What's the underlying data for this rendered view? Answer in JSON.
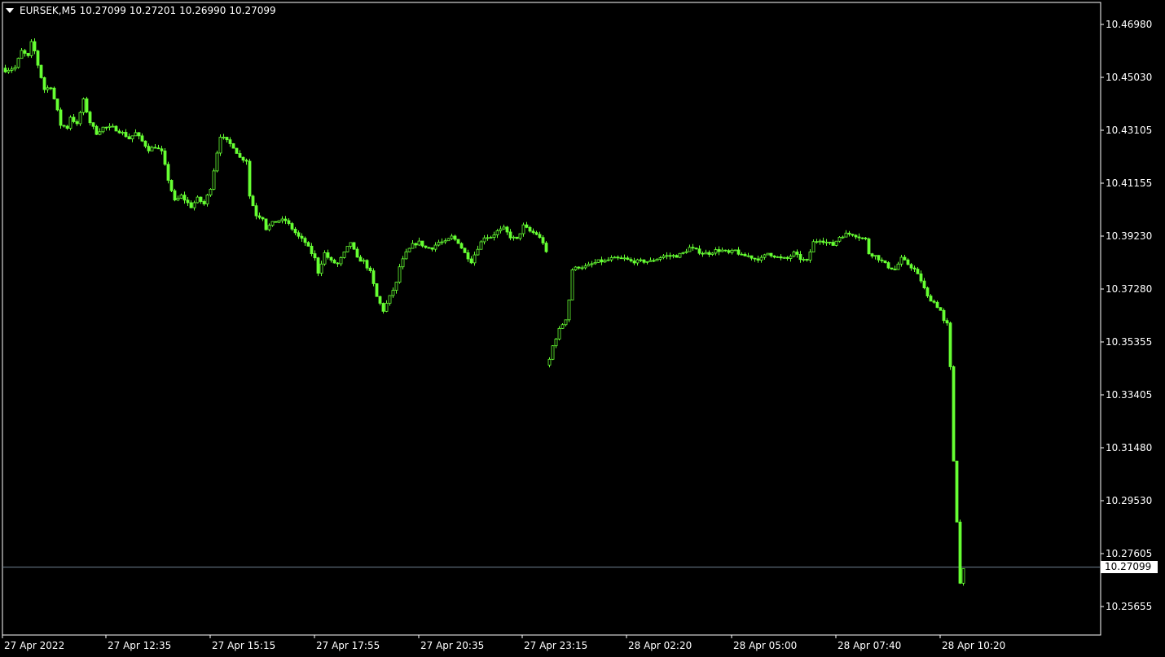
{
  "header": {
    "symbol": "EURSEK,M5",
    "open": "10.27099",
    "high": "10.27201",
    "low": "10.26990",
    "close": "10.27099"
  },
  "colors": {
    "background": "#000000",
    "candle": "#66ff33",
    "frame": "#ffffff",
    "grid_line": "#708090",
    "label_bg": "#ffffff",
    "label_text": "#000000"
  },
  "chart_data": {
    "type": "candlestick",
    "timeframe": "M5",
    "ylim": [
      10.252,
      10.477
    ],
    "y_ticks": [
      "10.46980",
      "10.45030",
      "10.43105",
      "10.41155",
      "10.39230",
      "10.37280",
      "10.35355",
      "10.33405",
      "10.31480",
      "10.29530",
      "10.27605",
      "10.25655"
    ],
    "x_ticks": [
      "27 Apr 2022",
      "27 Apr 12:35",
      "27 Apr 15:15",
      "27 Apr 17:55",
      "27 Apr 20:35",
      "27 Apr 23:15",
      "28 Apr 02:20",
      "28 Apr 05:00",
      "28 Apr 07:40",
      "28 Apr 10:20"
    ],
    "current_price": "10.27099",
    "close_path": [
      [
        0,
        10.453
      ],
      [
        3,
        10.454
      ],
      [
        5,
        10.46
      ],
      [
        7,
        10.458
      ],
      [
        8,
        10.463
      ],
      [
        9,
        10.46
      ],
      [
        10,
        10.455
      ],
      [
        12,
        10.446
      ],
      [
        14,
        10.447
      ],
      [
        16,
        10.438
      ],
      [
        17,
        10.433
      ],
      [
        19,
        10.432
      ],
      [
        20,
        10.436
      ],
      [
        22,
        10.433
      ],
      [
        24,
        10.442
      ],
      [
        26,
        10.434
      ],
      [
        28,
        10.43
      ],
      [
        30,
        10.432
      ],
      [
        33,
        10.432
      ],
      [
        36,
        10.43
      ],
      [
        38,
        10.428
      ],
      [
        40,
        10.43
      ],
      [
        42,
        10.427
      ],
      [
        44,
        10.424
      ],
      [
        46,
        10.425
      ],
      [
        48,
        10.423
      ],
      [
        50,
        10.413
      ],
      [
        52,
        10.405
      ],
      [
        54,
        10.407
      ],
      [
        57,
        10.403
      ],
      [
        59,
        10.406
      ],
      [
        61,
        10.404
      ],
      [
        63,
        10.41
      ],
      [
        65,
        10.423
      ],
      [
        66,
        10.429
      ],
      [
        68,
        10.427
      ],
      [
        70,
        10.425
      ],
      [
        72,
        10.421
      ],
      [
        74,
        10.42
      ],
      [
        75,
        10.407
      ],
      [
        77,
        10.4
      ],
      [
        79,
        10.399
      ],
      [
        80,
        10.395
      ],
      [
        82,
        10.397
      ],
      [
        84,
        10.398
      ],
      [
        86,
        10.398
      ],
      [
        88,
        10.395
      ],
      [
        90,
        10.392
      ],
      [
        92,
        10.39
      ],
      [
        94,
        10.386
      ],
      [
        95,
        10.384
      ],
      [
        96,
        10.379
      ],
      [
        98,
        10.386
      ],
      [
        100,
        10.383
      ],
      [
        102,
        10.382
      ],
      [
        104,
        10.386
      ],
      [
        106,
        10.39
      ],
      [
        108,
        10.384
      ],
      [
        110,
        10.383
      ],
      [
        112,
        10.379
      ],
      [
        114,
        10.37
      ],
      [
        116,
        10.365
      ],
      [
        118,
        10.37
      ],
      [
        120,
        10.375
      ],
      [
        121,
        10.381
      ],
      [
        123,
        10.386
      ],
      [
        125,
        10.389
      ],
      [
        127,
        10.39
      ],
      [
        129,
        10.388
      ],
      [
        131,
        10.388
      ],
      [
        133,
        10.39
      ],
      [
        135,
        10.39
      ],
      [
        137,
        10.392
      ],
      [
        139,
        10.39
      ],
      [
        141,
        10.386
      ],
      [
        143,
        10.383
      ],
      [
        145,
        10.388
      ],
      [
        147,
        10.392
      ],
      [
        149,
        10.392
      ],
      [
        151,
        10.394
      ],
      [
        153,
        10.395
      ],
      [
        155,
        10.392
      ],
      [
        157,
        10.391
      ],
      [
        159,
        10.396
      ],
      [
        161,
        10.394
      ],
      [
        163,
        10.393
      ],
      [
        165,
        10.39
      ],
      [
        166,
        10.386
      ],
      [
        167,
        10.347
      ],
      [
        168,
        10.352
      ],
      [
        170,
        10.358
      ],
      [
        172,
        10.362
      ],
      [
        173,
        10.369
      ],
      [
        174,
        10.38
      ],
      [
        176,
        10.381
      ],
      [
        178,
        10.381
      ],
      [
        180,
        10.382
      ],
      [
        182,
        10.383
      ],
      [
        184,
        10.383
      ],
      [
        186,
        10.384
      ],
      [
        188,
        10.384
      ],
      [
        190,
        10.384
      ],
      [
        192,
        10.383
      ],
      [
        194,
        10.383
      ],
      [
        196,
        10.383
      ],
      [
        198,
        10.383
      ],
      [
        200,
        10.384
      ],
      [
        202,
        10.385
      ],
      [
        204,
        10.385
      ],
      [
        206,
        10.385
      ],
      [
        208,
        10.386
      ],
      [
        210,
        10.388
      ],
      [
        212,
        10.387
      ],
      [
        214,
        10.386
      ],
      [
        216,
        10.386
      ],
      [
        218,
        10.387
      ],
      [
        220,
        10.387
      ],
      [
        222,
        10.386
      ],
      [
        224,
        10.387
      ],
      [
        226,
        10.385
      ],
      [
        228,
        10.385
      ],
      [
        230,
        10.384
      ],
      [
        232,
        10.384
      ],
      [
        234,
        10.386
      ],
      [
        236,
        10.385
      ],
      [
        238,
        10.384
      ],
      [
        240,
        10.384
      ],
      [
        242,
        10.386
      ],
      [
        244,
        10.384
      ],
      [
        246,
        10.383
      ],
      [
        248,
        10.39
      ],
      [
        250,
        10.391
      ],
      [
        252,
        10.39
      ],
      [
        254,
        10.389
      ],
      [
        256,
        10.392
      ],
      [
        258,
        10.393
      ],
      [
        260,
        10.393
      ],
      [
        262,
        10.392
      ],
      [
        264,
        10.391
      ],
      [
        265,
        10.386
      ],
      [
        267,
        10.385
      ],
      [
        269,
        10.383
      ],
      [
        271,
        10.381
      ],
      [
        273,
        10.38
      ],
      [
        275,
        10.384
      ],
      [
        277,
        10.382
      ],
      [
        279,
        10.38
      ],
      [
        281,
        10.376
      ],
      [
        283,
        10.37
      ],
      [
        285,
        10.368
      ],
      [
        287,
        10.365
      ],
      [
        288,
        10.361
      ],
      [
        289,
        10.36
      ],
      [
        290,
        10.344
      ],
      [
        291,
        10.31
      ],
      [
        292,
        10.288
      ],
      [
        293,
        10.265
      ],
      [
        294,
        10.271
      ]
    ]
  }
}
